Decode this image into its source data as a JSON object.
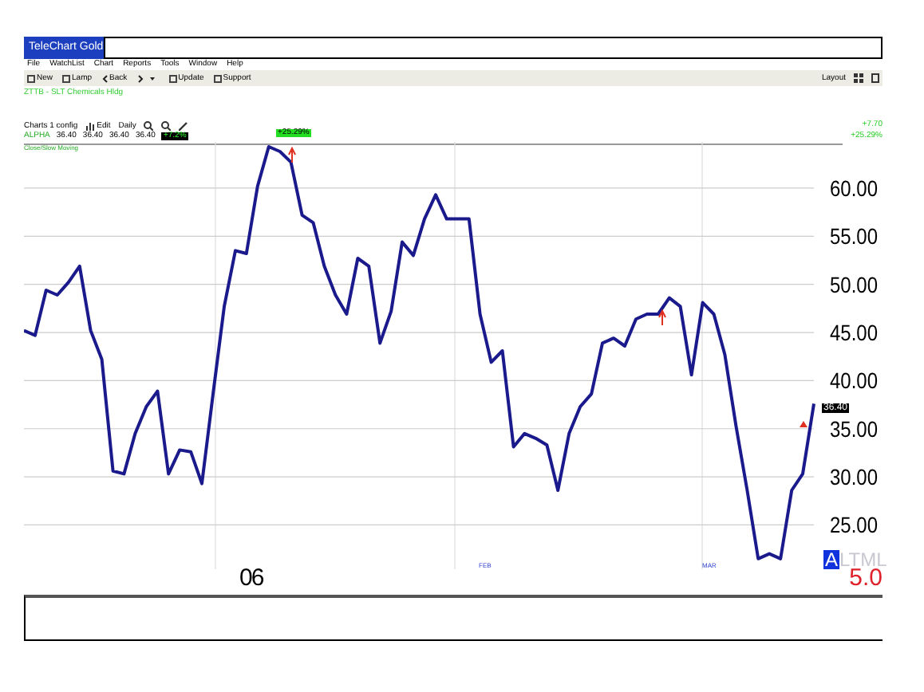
{
  "window": {
    "title": "TeleChart Gold"
  },
  "menu": [
    "File",
    "WatchList",
    "Chart",
    "Reports",
    "Tools",
    "Window",
    "Help"
  ],
  "toolbar": [
    {
      "kind": "button",
      "label": "New"
    },
    {
      "kind": "button",
      "label": "Lamp"
    },
    {
      "kind": "nav",
      "label": "Back"
    },
    {
      "kind": "button",
      "label": "Update"
    },
    {
      "kind": "button",
      "label": "Support"
    }
  ],
  "layout_label": "Layout",
  "symbol_title": "ZTTB - SLT Chemicals Hldg",
  "chart_header": {
    "config": "Charts 1 config",
    "edit": "Edit",
    "period": "Daily",
    "change": "+7.70",
    "change_pct": "+25.29%"
  },
  "quote_row": {
    "symbol": "ALPHA",
    "values": [
      "36.40",
      "36.40",
      "36.40",
      "36.40"
    ],
    "badge": "+7.2%"
  },
  "indicator_label": "Close/Slow Moving",
  "peak_label": "+25.29%",
  "last_price": "36.40",
  "chart_data": {
    "type": "line",
    "grid": true,
    "ylim": [
      20.4,
      64.8
    ],
    "yticks": [
      {
        "value": 25,
        "label": "25.00"
      },
      {
        "value": 30,
        "label": "30.00"
      },
      {
        "value": 35,
        "label": "35.00"
      },
      {
        "value": 40,
        "label": "40.00"
      },
      {
        "value": 45,
        "label": "45.00"
      },
      {
        "value": 50,
        "label": "50.00"
      },
      {
        "value": 55,
        "label": "55.00"
      },
      {
        "value": 60,
        "label": "60.00"
      }
    ],
    "series": [
      {
        "color": "#1a1a8c",
        "values": [
          45.2,
          44.7,
          49.4,
          48.9,
          50.2,
          51.9,
          45.2,
          42.2,
          30.6,
          30.3,
          34.5,
          37.3,
          38.9,
          30.3,
          32.8,
          32.6,
          29.3,
          38.6,
          47.7,
          53.5,
          53.2,
          60.2,
          64.3,
          63.8,
          62.7,
          57.2,
          56.4,
          51.9,
          48.9,
          46.9,
          52.7,
          51.9,
          43.9,
          47.2,
          54.4,
          53.0,
          56.8,
          59.3,
          56.8,
          56.8,
          56.8,
          46.9,
          41.9,
          43.1,
          33.1,
          34.5,
          34.0,
          33.3,
          28.6,
          34.5,
          37.3,
          38.6,
          43.9,
          44.4,
          43.6,
          46.4,
          46.9,
          46.9,
          48.6,
          47.7,
          40.6,
          48.1,
          46.9,
          42.7,
          35.3,
          28.6,
          21.5,
          22.0,
          21.5,
          28.6,
          30.3,
          37.6
        ]
      }
    ]
  },
  "x_labels": [
    "06",
    "FEB",
    "MAR"
  ],
  "corner": {
    "badge": "A",
    "text": "LTML",
    "value": "5.0"
  }
}
